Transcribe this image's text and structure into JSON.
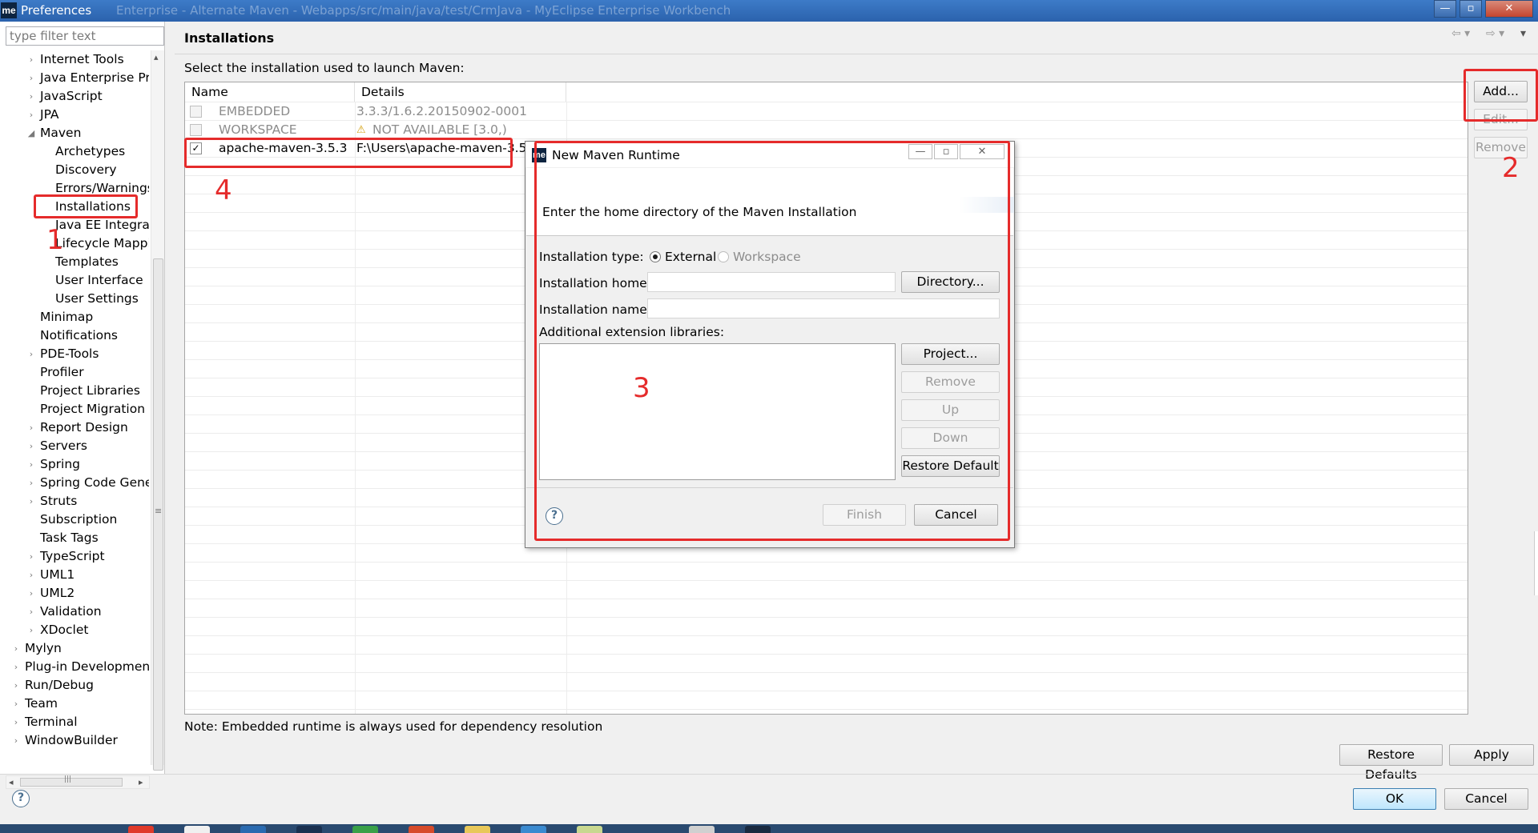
{
  "window": {
    "app_icon": "me",
    "title": "Preferences",
    "faded_title": "Enterprise - Alternate Maven - Webapps/src/main/java/test/CrmJava - MyEclipse Enterprise Workbench",
    "minimize": "—",
    "maximize": "▫",
    "close": "✕"
  },
  "sidebar": {
    "filter_placeholder": "type filter text",
    "items": [
      {
        "label": "Internet Tools",
        "depth": 1,
        "expander": "›"
      },
      {
        "label": "Java Enterprise Pro",
        "depth": 1,
        "expander": "›"
      },
      {
        "label": "JavaScript",
        "depth": 1,
        "expander": "›"
      },
      {
        "label": "JPA",
        "depth": 1,
        "expander": "›"
      },
      {
        "label": "Maven",
        "depth": 1,
        "expander": "◢"
      },
      {
        "label": "Archetypes",
        "depth": 2,
        "expander": ""
      },
      {
        "label": "Discovery",
        "depth": 2,
        "expander": ""
      },
      {
        "label": "Errors/Warnings",
        "depth": 2,
        "expander": ""
      },
      {
        "label": "Installations",
        "depth": 2,
        "expander": "",
        "selected": true
      },
      {
        "label": "Java EE Integrati",
        "depth": 2,
        "expander": ""
      },
      {
        "label": "Lifecycle Mappi",
        "depth": 2,
        "expander": ""
      },
      {
        "label": "Templates",
        "depth": 2,
        "expander": ""
      },
      {
        "label": "User Interface",
        "depth": 2,
        "expander": ""
      },
      {
        "label": "User Settings",
        "depth": 2,
        "expander": ""
      },
      {
        "label": "Minimap",
        "depth": 1,
        "expander": ""
      },
      {
        "label": "Notifications",
        "depth": 1,
        "expander": ""
      },
      {
        "label": "PDE-Tools",
        "depth": 1,
        "expander": "›"
      },
      {
        "label": "Profiler",
        "depth": 1,
        "expander": ""
      },
      {
        "label": "Project Libraries",
        "depth": 1,
        "expander": ""
      },
      {
        "label": "Project Migration",
        "depth": 1,
        "expander": ""
      },
      {
        "label": "Report Design",
        "depth": 1,
        "expander": "›"
      },
      {
        "label": "Servers",
        "depth": 1,
        "expander": "›"
      },
      {
        "label": "Spring",
        "depth": 1,
        "expander": "›"
      },
      {
        "label": "Spring Code Gener",
        "depth": 1,
        "expander": "›"
      },
      {
        "label": "Struts",
        "depth": 1,
        "expander": "›"
      },
      {
        "label": "Subscription",
        "depth": 1,
        "expander": ""
      },
      {
        "label": "Task Tags",
        "depth": 1,
        "expander": ""
      },
      {
        "label": "TypeScript",
        "depth": 1,
        "expander": "›"
      },
      {
        "label": "UML1",
        "depth": 1,
        "expander": "›"
      },
      {
        "label": "UML2",
        "depth": 1,
        "expander": "›"
      },
      {
        "label": "Validation",
        "depth": 1,
        "expander": "›"
      },
      {
        "label": "XDoclet",
        "depth": 1,
        "expander": "›"
      },
      {
        "label": "Mylyn",
        "depth": 0,
        "expander": "›"
      },
      {
        "label": "Plug-in Development",
        "depth": 0,
        "expander": "›"
      },
      {
        "label": "Run/Debug",
        "depth": 0,
        "expander": "›"
      },
      {
        "label": "Team",
        "depth": 0,
        "expander": "›"
      },
      {
        "label": "Terminal",
        "depth": 0,
        "expander": "›"
      },
      {
        "label": "WindowBuilder",
        "depth": 0,
        "expander": "›"
      }
    ],
    "scroll_left": "◂",
    "scroll_right": "▸",
    "scroll_up": "▴",
    "scroll_grip": "≡",
    "hscroll_grip": "|||"
  },
  "page": {
    "title": "Installations",
    "nav_back": "⇦ ▾",
    "nav_forward": "⇨ ▾",
    "menu": "▾",
    "instruction": "Select the installation used to launch Maven:",
    "columns": [
      "Name",
      "Details"
    ],
    "rows": [
      {
        "name": "EMBEDDED",
        "details": "3.3.3/1.6.2.20150902-0001",
        "checked": false,
        "enabled": false,
        "warning": false
      },
      {
        "name": "WORKSPACE",
        "details": "NOT AVAILABLE [3.0,)",
        "checked": false,
        "enabled": false,
        "warning": true
      },
      {
        "name": "apache-maven-3.5.3",
        "details": "F:\\Users\\apache-maven-3.5.3",
        "checked": true,
        "enabled": true,
        "warning": false
      }
    ],
    "check_mark": "✓",
    "warning_icon": "⚠",
    "add_button": "Add...",
    "edit_button": "Edit...",
    "remove_button": "Remove",
    "note": "Note: Embedded runtime is always used for dependency resolution",
    "restore_defaults_button": "Restore Defaults",
    "apply_button": "Apply",
    "help_icon": "?",
    "ok_button": "OK",
    "cancel_button": "Cancel"
  },
  "dialog": {
    "icon": "me",
    "title": "New Maven Runtime",
    "minimize": "—",
    "maximize": "▫",
    "close": "✕",
    "message": "Enter the home directory of the Maven Installation",
    "installation_type_label": "Installation type:",
    "radio_external": "External",
    "radio_workspace": "Workspace",
    "selected_type": "External",
    "installation_home_label": "Installation home:",
    "installation_home_value": "",
    "directory_button": "Directory...",
    "installation_name_label": "Installation name:",
    "installation_name_value": "",
    "extension_libraries_label": "Additional extension libraries:",
    "project_button": "Project...",
    "remove_button": "Remove",
    "up_button": "Up",
    "down_button": "Down",
    "restore_default_button": "Restore Default",
    "help_icon": "?",
    "finish_button": "Finish",
    "cancel_button": "Cancel"
  },
  "annotations": {
    "color": "#e52b2b",
    "labels": [
      "1",
      "2",
      "3",
      "4"
    ]
  }
}
